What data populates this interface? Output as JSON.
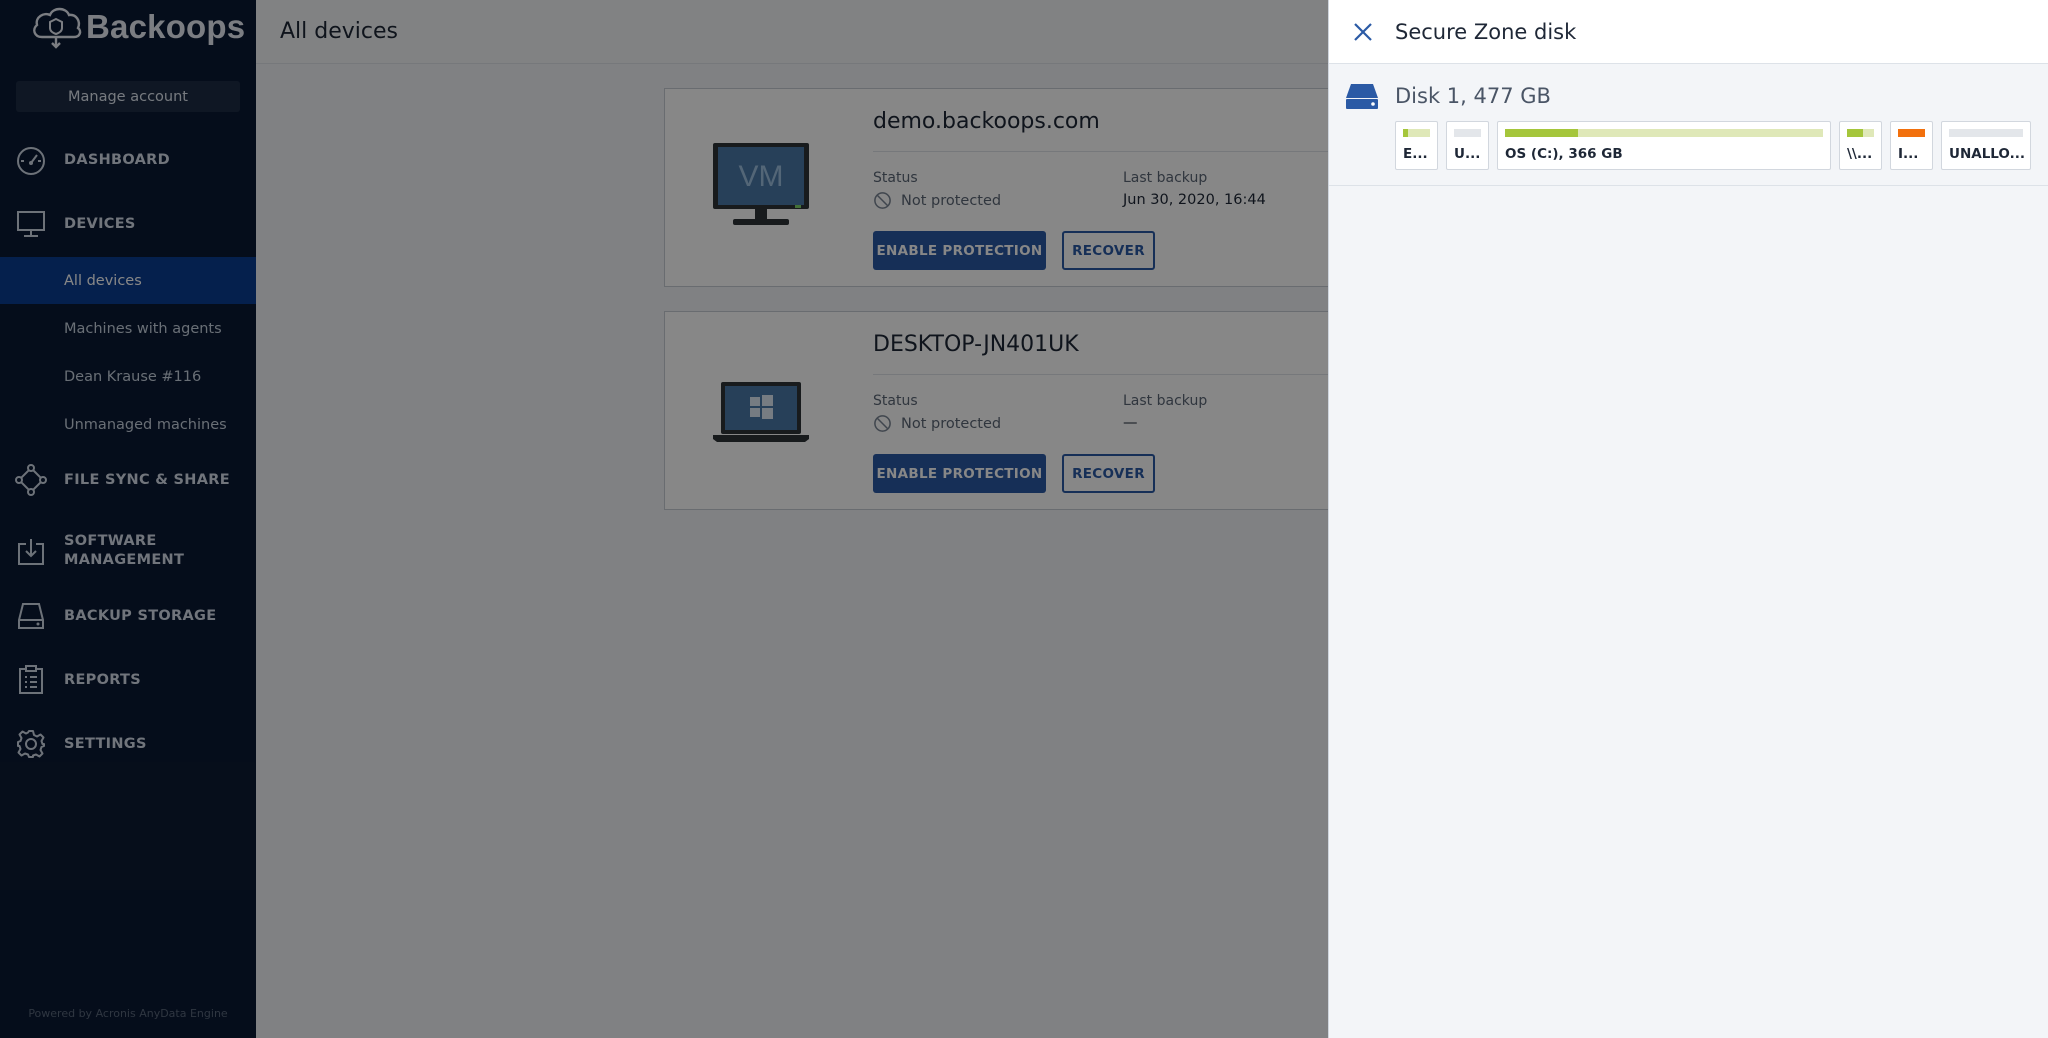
{
  "app": {
    "brand": "Backoops"
  },
  "sidebar": {
    "manage_account": "Manage account",
    "nav": [
      {
        "label": "DASHBOARD",
        "icon": "dashboard-icon"
      },
      {
        "label": "DEVICES",
        "icon": "monitor-icon"
      },
      {
        "label": "FILE SYNC & SHARE",
        "icon": "share-icon"
      },
      {
        "label": "SOFTWARE",
        "label2": "MANAGEMENT",
        "icon": "download-box-icon"
      },
      {
        "label": "BACKUP STORAGE",
        "icon": "storage-icon"
      },
      {
        "label": "REPORTS",
        "icon": "clipboard-icon"
      },
      {
        "label": "SETTINGS",
        "icon": "gear-icon"
      }
    ],
    "devices_sub": [
      "All devices",
      "Machines with agents",
      "Dean Krause #116",
      "Unmanaged machines"
    ],
    "active_sub": "All devices",
    "powered_by": "Powered by Acronis AnyData Engine"
  },
  "main": {
    "title": "All devices",
    "devices": [
      {
        "name": "demo.backoops.com",
        "type_badge": "VM",
        "status_label": "Status",
        "status": "Not protected",
        "last_backup_label": "Last backup",
        "last_backup": "Jun 30, 2020, 16:44",
        "enable_label": "ENABLE PROTECTION",
        "recover_label": "RECOVER"
      },
      {
        "name": "DESKTOP-JN401UK",
        "status_label": "Status",
        "status": "Not protected",
        "last_backup_label": "Last backup",
        "last_backup": "—",
        "enable_label": "ENABLE PROTECTION",
        "recover_label": "RECOVER"
      }
    ]
  },
  "panel": {
    "title": "Secure Zone disk",
    "disk_title": "Disk 1, 477 GB",
    "partitions": [
      {
        "label": "E...",
        "used": 0.2,
        "color": "#a5c63b",
        "free_color": "#dfe8b8"
      },
      {
        "label": "U...",
        "used": 0.0,
        "color": "#a5c63b",
        "free_color": "#e3e6ea"
      },
      {
        "label": "OS (C:), 366 GB",
        "used": 0.23,
        "color": "#a5c63b",
        "free_color": "#dfe8b8"
      },
      {
        "label": "\\\\...",
        "used": 0.6,
        "color": "#a5c63b",
        "free_color": "#dfe8b8"
      },
      {
        "label": "I...",
        "used": 1.0,
        "color": "#f2700d",
        "free_color": "#f2700d"
      },
      {
        "label": "UNALLO...",
        "used": 0.0,
        "color": "#a5c63b",
        "free_color": "#e3e6ea"
      }
    ],
    "colors": {
      "accent": "#2b5aa5",
      "used": "#a5c63b",
      "orange": "#f2700d"
    }
  }
}
